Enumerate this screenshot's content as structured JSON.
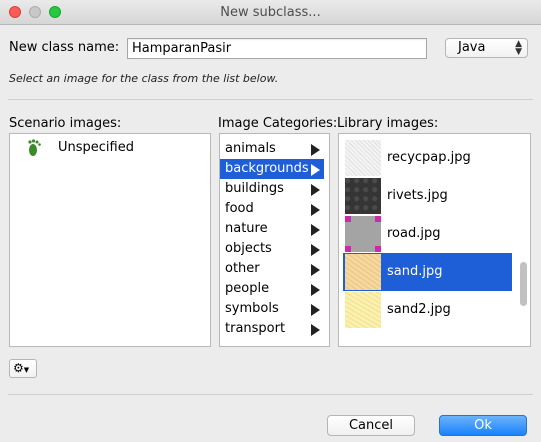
{
  "window": {
    "title": "New subclass..."
  },
  "form": {
    "class_name_label": "New class name:",
    "class_name_value": "HamparanPasir",
    "language": "Java",
    "hint": "Select an image for the class from the list below."
  },
  "scenario": {
    "label": "Scenario images:",
    "items": [
      {
        "label": "Unspecified",
        "icon": "footprint-icon"
      }
    ]
  },
  "categories": {
    "label": "Image Categories:",
    "selected": "backgrounds",
    "items": [
      "animals",
      "backgrounds",
      "buildings",
      "food",
      "nature",
      "objects",
      "other",
      "people",
      "symbols",
      "transport"
    ]
  },
  "library": {
    "label": "Library images:",
    "selected": "sand.jpg",
    "items": [
      "recycpap.jpg",
      "rivets.jpg",
      "road.jpg",
      "sand.jpg",
      "sand2.jpg"
    ]
  },
  "buttons": {
    "cancel": "Cancel",
    "ok": "Ok"
  },
  "colors": {
    "selection": "#1e5ed6",
    "ok_button": "#1a82fb"
  }
}
